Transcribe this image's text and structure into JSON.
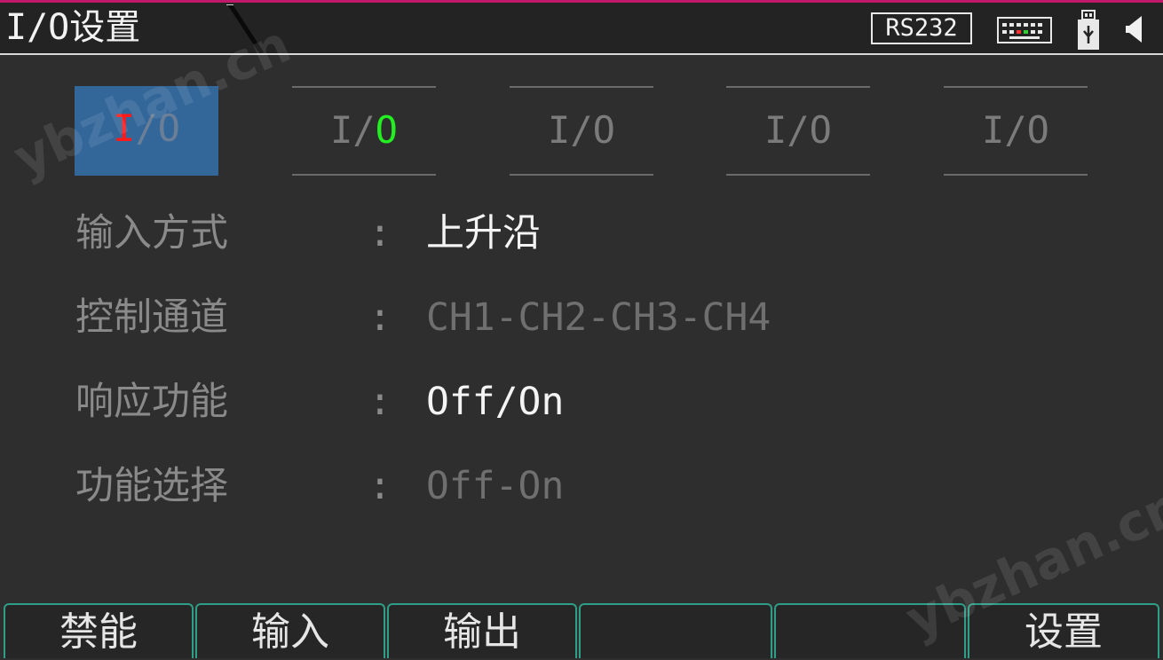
{
  "header": {
    "title": "I/O设置",
    "rs232_label": "RS232",
    "icons": [
      "keyboard-icon",
      "usb-icon",
      "speaker-icon"
    ]
  },
  "tabs": [
    {
      "prefix": "I",
      "slash": "/",
      "suffix": "O",
      "state": "active"
    },
    {
      "prefix": "I",
      "slash": "/",
      "suffix": "O",
      "state": "green"
    },
    {
      "prefix": "I",
      "slash": "/",
      "suffix": "O",
      "state": "inactive"
    },
    {
      "prefix": "I",
      "slash": "/",
      "suffix": "O",
      "state": "inactive"
    },
    {
      "prefix": "I",
      "slash": "/",
      "suffix": "O",
      "state": "inactive"
    }
  ],
  "settings": [
    {
      "label": "输入方式",
      "colon": ":",
      "value": "上升沿",
      "enabled": true
    },
    {
      "label": "控制通道",
      "colon": ":",
      "value": "CH1-CH2-CH3-CH4",
      "enabled": false
    },
    {
      "label": "响应功能",
      "colon": ":",
      "value": "Off/On",
      "enabled": true
    },
    {
      "label": "功能选择",
      "colon": ":",
      "value": "Off-On",
      "enabled": false
    }
  ],
  "softkeys": [
    "禁能",
    "输入",
    "输出",
    "",
    "",
    "设置"
  ],
  "watermark": "ybzhan.cn",
  "colors": {
    "background": "#2e2e2e",
    "active_tab": "#336699",
    "active_io_marker": "#ff1a1a",
    "io_highlight": "#22ee22",
    "softkey_border": "#2f9e87",
    "top_accent": "#c2186a"
  }
}
